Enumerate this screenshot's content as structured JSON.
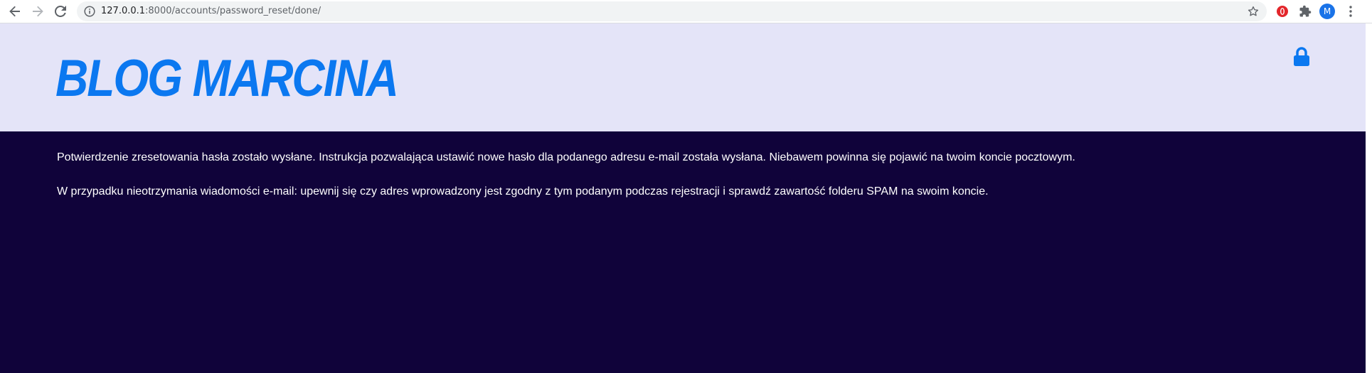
{
  "browser": {
    "url_host": "127.0.0.1",
    "url_rest": ":8000/accounts/password_reset/done/",
    "profile_initial": "M",
    "icons": {
      "back": "back-arrow-icon",
      "forward": "forward-arrow-icon",
      "reload": "reload-icon",
      "info": "info-icon",
      "bookmark": "star-icon",
      "extension_opera": "opera-icon",
      "extensions": "puzzle-icon",
      "menu": "kebab-menu-icon"
    }
  },
  "header": {
    "site_title": "Blog Marcina",
    "login_icon": "lock-icon",
    "background": "#e4e4f8",
    "accent": "#0b78f0"
  },
  "main": {
    "background": "#10033a",
    "paragraphs": {
      "confirmation": "Potwierdzenie zresetowania hasła zostało wysłane. Instrukcja pozwalająca ustawić nowe hasło dla podanego adresu e-mail została wysłana. Niebawem powinna się pojawić na twoim koncie pocztowym.",
      "spam_hint": "W przypadku nieotrzymania wiadomości e-mail: upewnij się czy adres wprowadzony jest zgodny z tym podanym podczas rejestracji i sprawdź zawartość folderu SPAM na swoim koncie."
    }
  }
}
